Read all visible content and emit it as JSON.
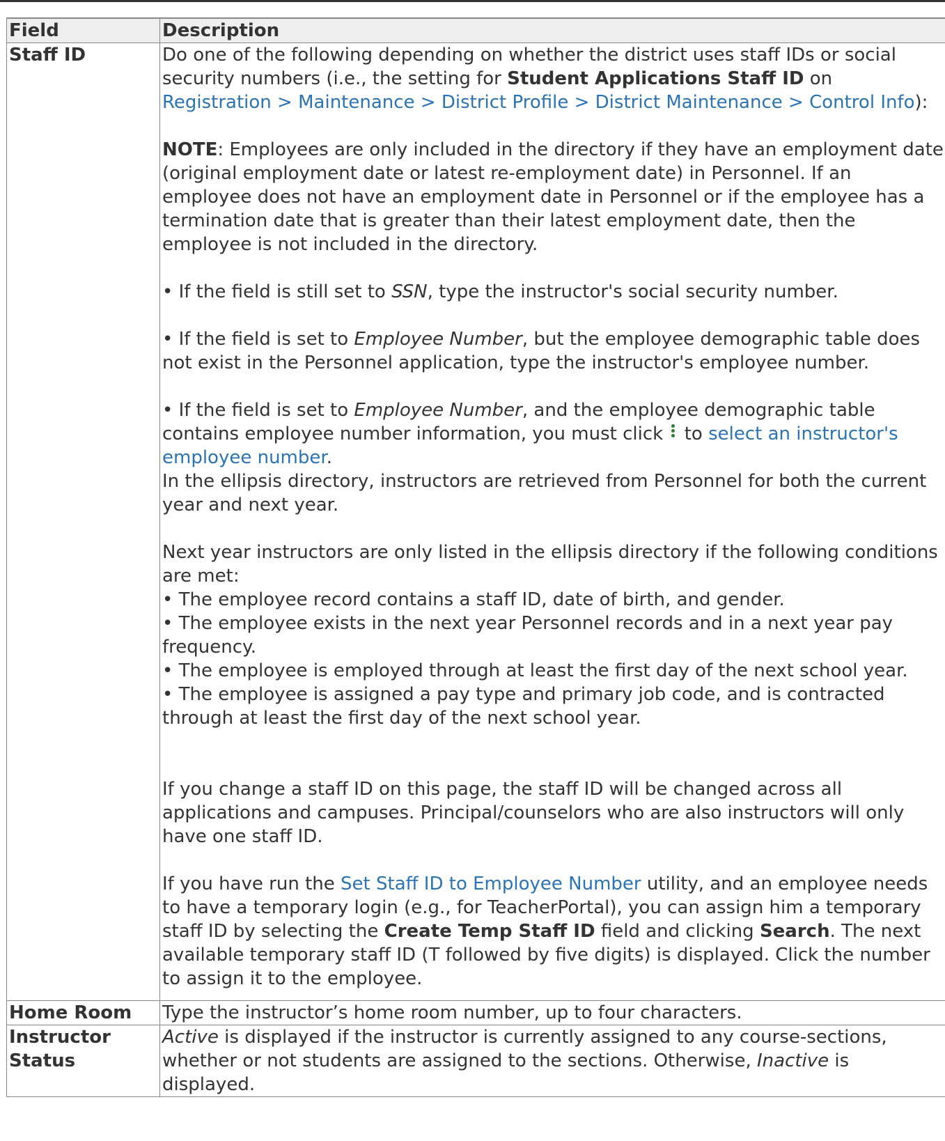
{
  "table": {
    "headers": {
      "field": "Field",
      "description": "Description"
    },
    "staff_id": {
      "field": "Staff ID",
      "intro": {
        "t1": "Do one of the following depending on whether the district uses staff IDs or social security numbers (i.e., the setting for ",
        "b1": "Student Applications Staff ID",
        "t2": " on ",
        "link": "Registration > Maintenance > District Profile > District Maintenance > Control Info",
        "t3": "):"
      },
      "note": {
        "label": "NOTE",
        "text": ": Employees are only included in the directory if they have an employment date (original employment date or latest re-employment date) in Personnel. If an employee does not have an employment date in Personnel or if the employee has a termination date that is greater than their latest employment date, then the employee is not included in the directory."
      },
      "bullet_ssn": {
        "t1": "• If the field is still set to ",
        "em": "SSN",
        "t2": ", type the instructor's social security number."
      },
      "bullet_empnum": {
        "t1": "• If the field is set to ",
        "em": "Employee Number",
        "t2": ", but the employee demographic table does not exist in the Personnel application, type the instructor's employee number."
      },
      "bullet_empnum_table": {
        "t1": "• If the field is set to ",
        "em": "Employee Number",
        "t2": ", and the employee demographic table contains employee number information, you must click ",
        "t3": " to ",
        "link": "select an instructor's employee number",
        "t4": "."
      },
      "ellipsis_text": "In the ellipsis directory, instructors are retrieved from Personnel for both the current year and next year.",
      "next_year_intro": "Next year instructors are only listed in the ellipsis directory if the following conditions are met:",
      "conditions": [
        "• The employee record contains a staff ID, date of birth, and gender.",
        "• The employee exists in the next year Personnel records and in a next year pay frequency.",
        "• The employee is employed through at least the first day of the next school year.",
        "• The employee is assigned a pay type and primary job code, and is contracted through at least the first day of the next school year."
      ],
      "change_text": "If you change a staff ID on this page, the staff ID will be changed across all applications and campuses. Principal/counselors who are also instructors will only have one staff ID.",
      "utility": {
        "t1": "If you have run the ",
        "link": "Set Staff ID to Employee Number",
        "t2": " utility, and an employee needs to have a temporary login (e.g., for TeacherPortal), you can assign him a temporary staff ID by selecting the ",
        "b1": "Create Temp Staff ID",
        "t3": " field and clicking ",
        "b2": "Search",
        "t4": ". The next available temporary staff ID (T followed by five digits) is displayed. Click the number to assign it to the employee."
      }
    },
    "home_room": {
      "field": "Home Room",
      "description": "Type the instructor’s home room number, up to four characters."
    },
    "instructor_status": {
      "field": "Instructor Status",
      "em1": "Active",
      "t1": " is displayed if the instructor is currently assigned to any course-sections, whether or not students are assigned to the sections. Otherwise, ",
      "em2": "Inactive",
      "t2": " is displayed."
    }
  },
  "colors": {
    "link": "#2b73b7",
    "text": "#333333",
    "header_bg": "#eeeeee",
    "border": "#888888",
    "icon": "#2e7d32"
  }
}
